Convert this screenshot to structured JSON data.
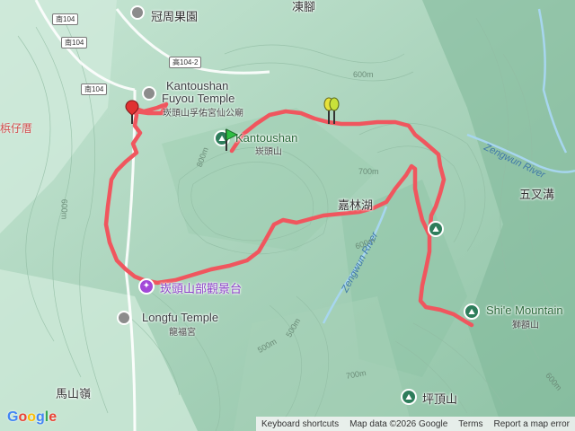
{
  "map": {
    "route_color": "#f0565e",
    "terrain_color": "#b9dcc8",
    "river_color": "#9fd0ea"
  },
  "road_shields": [
    "南104",
    "南104",
    "高104-2",
    "南104"
  ],
  "places": {
    "guanzhou": "冠周果園",
    "liaojing": "凍腳",
    "fuyou_en1": "Kantoushan",
    "fuyou_en2": "Fuyou Temple",
    "fuyou_zh": "崁頭山孚佑宮仙公廟",
    "zaizicuo": "梹仔厝",
    "kantoushan_en": "Kantoushan",
    "kantoushan_zh": "崁頭山",
    "jialin_lake": "嘉林湖",
    "wuchagou": "五叉溝",
    "zengwun_river1": "Zengwun River",
    "zengwun_river2": "Zengwun River",
    "lookout": "崁頭山部觀景台",
    "longfu_en": "Longfu Temple",
    "longfu_zh": "龍福宮",
    "shie_en": "Shi'e Mountain",
    "shie_zh": "獅額山",
    "mashan": "馬山嶺",
    "pingding": "坪頂山"
  },
  "elevations": [
    "600m",
    "800m",
    "700m",
    "600m",
    "700m",
    "600m",
    "500m",
    "500m",
    "600m"
  ],
  "footer": {
    "shortcuts": "Keyboard shortcuts",
    "mapdata": "Map data ©2026 Google",
    "terms": "Terms",
    "report": "Report a map error"
  },
  "logo": "Google",
  "icons": {
    "poi": "place-pin-icon",
    "start": "start-flag-icon",
    "end": "end-marker-icon",
    "waypoint": "waypoint-flag-icon",
    "trail": "hiking-icon",
    "viewpoint": "viewpoint-icon"
  }
}
